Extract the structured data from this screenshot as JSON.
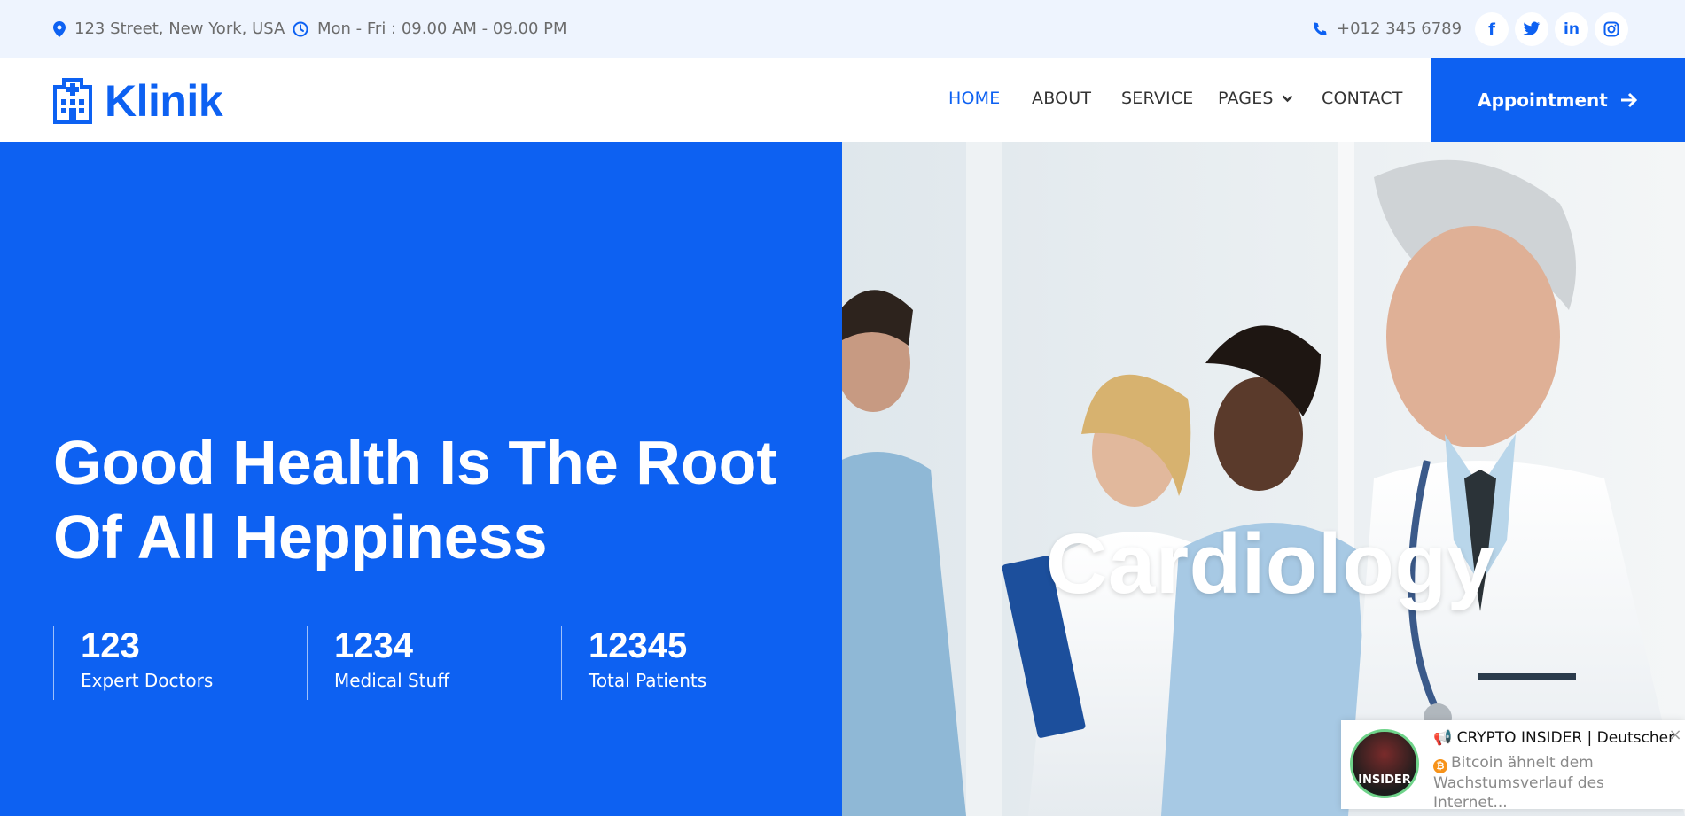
{
  "topbar": {
    "address": "123 Street, New York, USA",
    "hours": "Mon - Fri : 09.00 AM - 09.00 PM",
    "phone": "+012 345 6789",
    "social": [
      "f",
      "t",
      "in",
      "ig"
    ]
  },
  "navbar": {
    "brand": "Klinik",
    "links": [
      "HOME",
      "ABOUT",
      "SERVICE",
      "PAGES",
      "CONTACT"
    ],
    "active": "HOME",
    "appointment": "Appointment"
  },
  "hero": {
    "title": "Good Health Is The Root Of All Heppiness",
    "image_caption": "Cardiology",
    "stats": [
      {
        "value": "123",
        "label": "Expert Doctors"
      },
      {
        "value": "1234",
        "label": "Medical Stuff"
      },
      {
        "value": "12345",
        "label": "Total Patients"
      }
    ]
  },
  "notification": {
    "avatar_text": "INSIDER",
    "title": "📢 CRYPTO INSIDER | Deutscher",
    "body": "Bitcoin ähnelt dem Wachstumsverlauf des Internet...",
    "close": "×"
  },
  "colors": {
    "brand": "#0d61f2",
    "topbar_bg": "#eef4fe",
    "text_muted": "#6b6b6b"
  },
  "icons": {
    "address": "map-marker-icon",
    "hours": "clock-icon",
    "phone": "phone-icon",
    "logo": "hospital-icon",
    "pages_dropdown": "chevron-down-icon",
    "appointment": "arrow-right-icon",
    "notification_coin": "bitcoin-icon"
  }
}
